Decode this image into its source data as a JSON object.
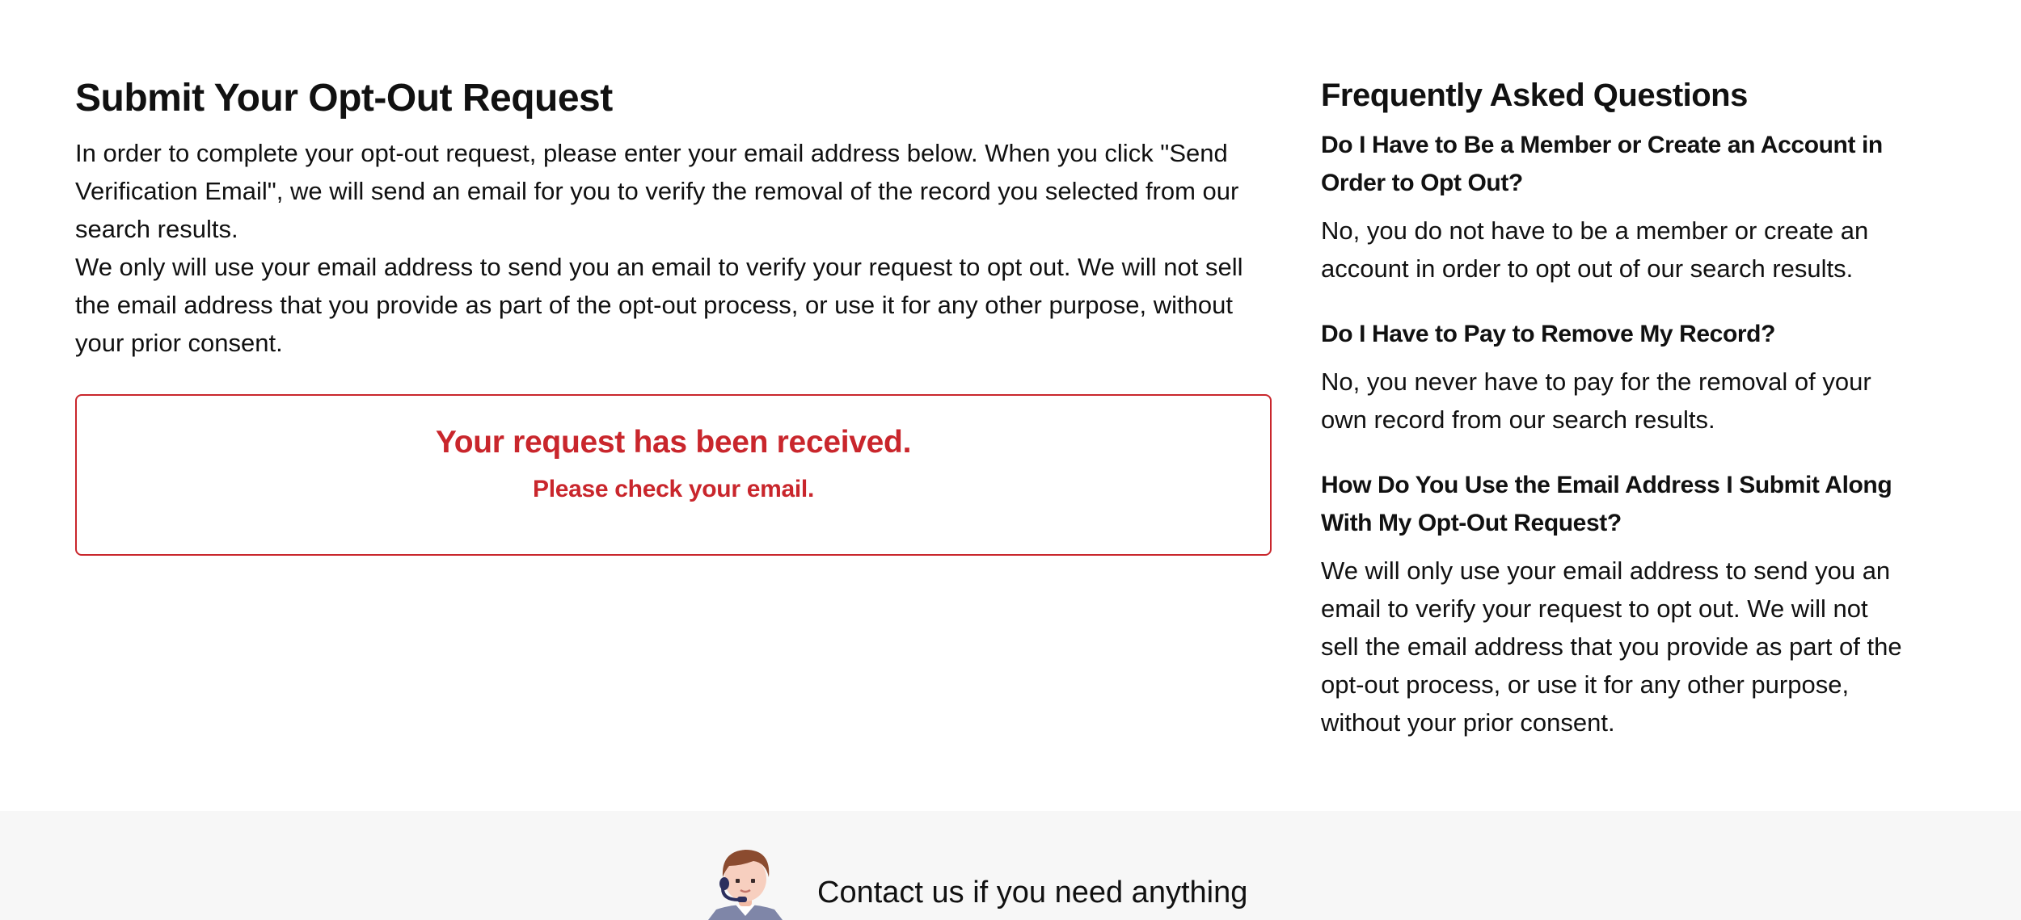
{
  "main": {
    "title": "Submit Your Opt-Out Request",
    "intro_paragraph_1": "In order to complete your opt-out request, please enter your email address below. When you click \"Send Verification Email\", we will send an email for you to verify the removal of the record you selected from our search results.",
    "intro_paragraph_2": "We only will use your email address to send you an email to verify your request to opt out. We will not sell the email address that you provide as part of the opt-out process, or use it for any other purpose, without your prior consent.",
    "notice": {
      "title": "Your request has been received.",
      "subtitle": "Please check your email.",
      "color": "#c9262c"
    }
  },
  "faq": {
    "title": "Frequently Asked Questions",
    "items": [
      {
        "question": "Do I Have to Be a Member or Create an Account in Order to Opt Out?",
        "answer": "No, you do not have to be a member or create an account in order to opt out of our search results."
      },
      {
        "question": "Do I Have to Pay to Remove My Record?",
        "answer": "No, you never have to pay for the removal of your own record from our search results."
      },
      {
        "question": "How Do You Use the Email Address I Submit Along With My Opt-Out Request?",
        "answer": "We will only use your email address to send you an email to verify your request to opt out. We will not sell the email address that you provide as part of the opt-out process, or use it for any other purpose, without your prior consent."
      }
    ]
  },
  "footer": {
    "contact_text": "Contact us if you need anything",
    "avatar_icon": "support-agent-icon",
    "background": "#f7f7f7"
  }
}
